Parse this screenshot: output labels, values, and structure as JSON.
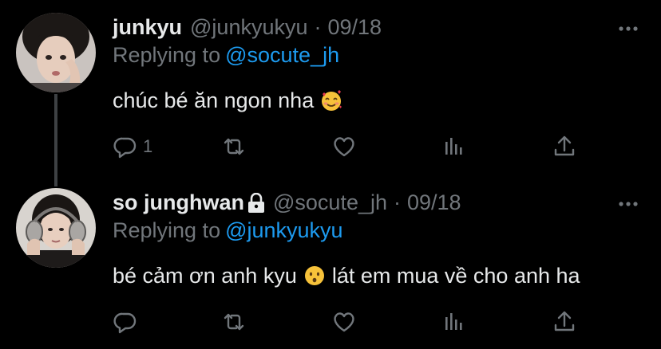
{
  "tweets": [
    {
      "display_name": "junkyu",
      "handle": "@junkyukyu",
      "separator": "·",
      "date": "09/18",
      "replying_prefix": "Replying to",
      "replying_to": "@socute_jh",
      "text": "chúc bé ăn ngon nha",
      "emoji_icon": "smiling-face-with-hearts-icon",
      "reply_count": "1",
      "protected": false
    },
    {
      "display_name": "so junghwan",
      "handle": "@socute_jh",
      "separator": "·",
      "date": "09/18",
      "replying_prefix": "Replying to",
      "replying_to": "@junkyukyu",
      "text_before_emoji": "bé cảm ơn anh kyu",
      "emoji_icon": "hushed-face-icon",
      "text_after_emoji": "lát em mua về cho anh ha",
      "reply_count": "",
      "protected": true
    }
  ],
  "colors": {
    "background": "#000000",
    "primary_text": "#e7e9ea",
    "secondary_text": "#71767b",
    "link": "#1d9bf0",
    "thread_line": "#3e4144"
  }
}
